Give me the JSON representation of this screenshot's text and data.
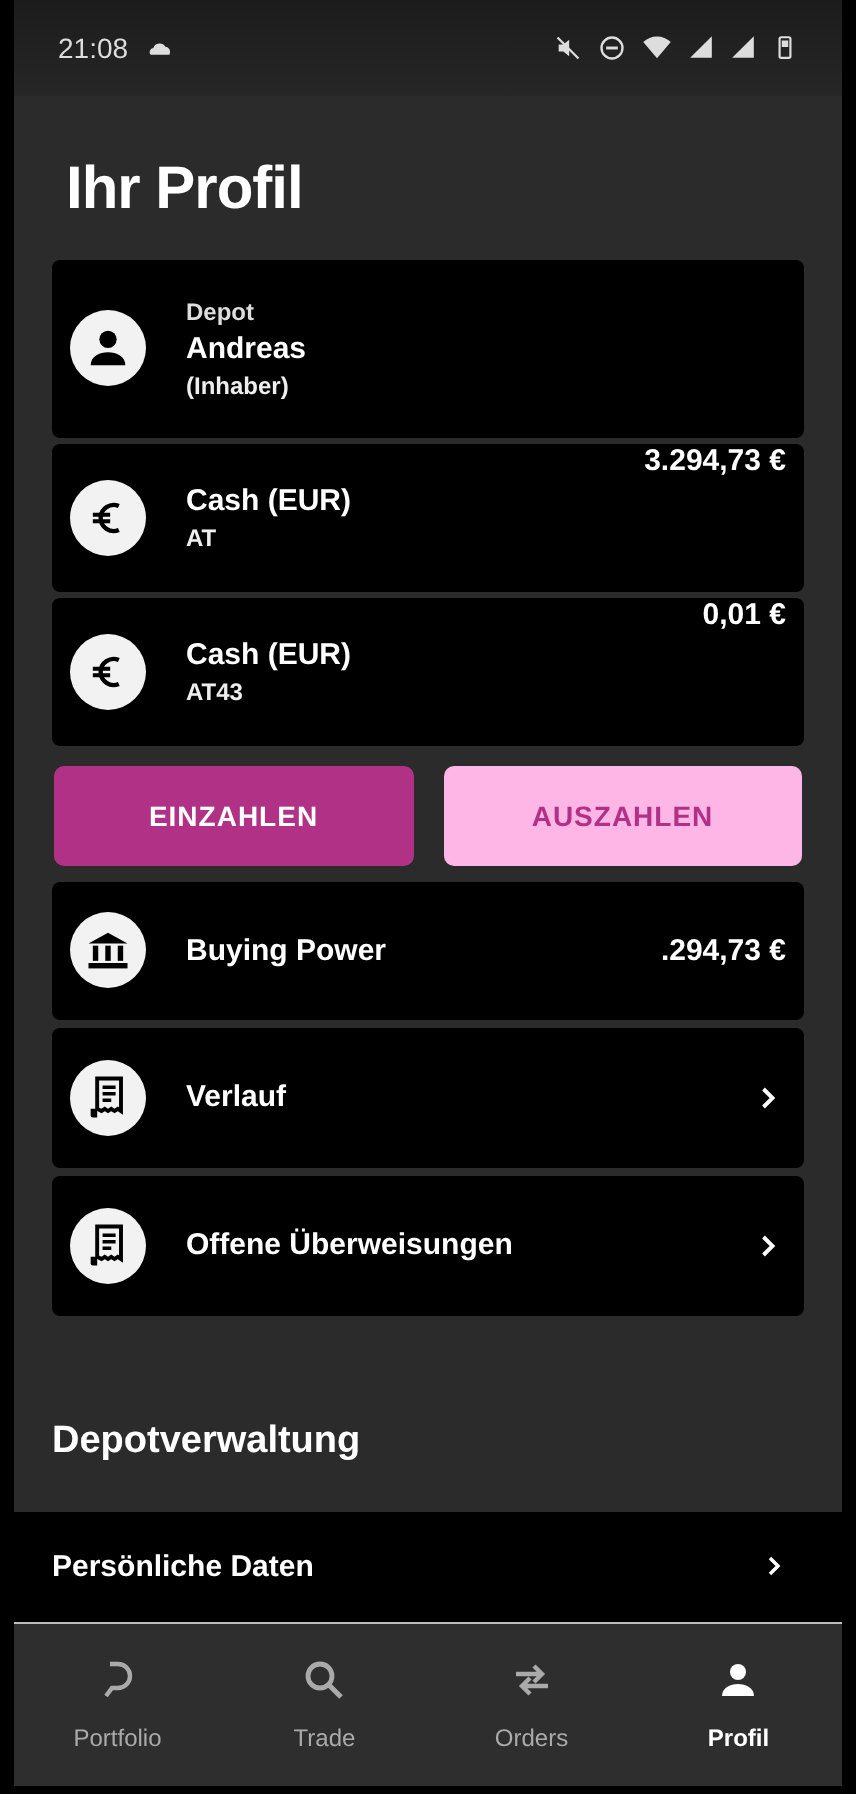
{
  "status_bar": {
    "time": "21:08"
  },
  "title": "Ihr Profil",
  "accounts": [
    {
      "kind": "depot",
      "label": "Depot",
      "name": "Andreas",
      "role": "(Inhaber)"
    },
    {
      "kind": "cash",
      "name": "Cash (EUR)",
      "sub": "AT",
      "amount": "3.294,73 €"
    },
    {
      "kind": "cash",
      "name": "Cash (EUR)",
      "sub": "AT43",
      "amount": "0,01 €"
    }
  ],
  "buttons": [
    {
      "label": "EINZAHLEN",
      "kind": "primary"
    },
    {
      "label": "AUSZAHLEN",
      "kind": "secondary"
    }
  ],
  "items": [
    {
      "kind": "value",
      "label": "Buying Power",
      "value": ".294,73 €"
    },
    {
      "kind": "link",
      "label": "Verlauf"
    },
    {
      "kind": "link",
      "label": "Offene Überweisungen"
    }
  ],
  "section": {
    "title": "Depotverwaltung",
    "rows": [
      {
        "label": "Persönliche Daten"
      }
    ]
  },
  "nav": [
    {
      "label": "Portfolio",
      "selected": false
    },
    {
      "label": "Trade",
      "selected": false
    },
    {
      "label": "Orders",
      "selected": false
    },
    {
      "label": "Profil",
      "selected": true
    }
  ]
}
